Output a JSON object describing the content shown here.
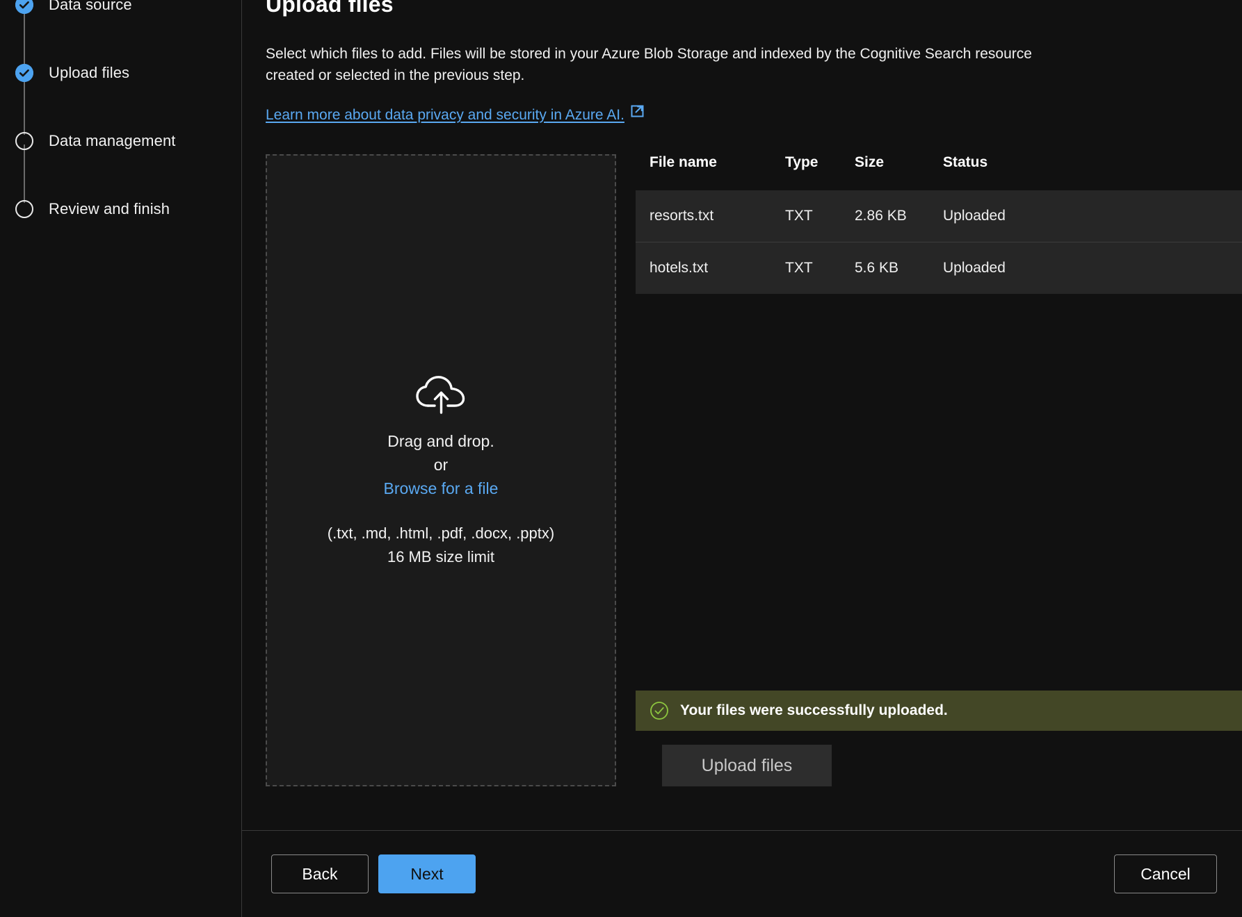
{
  "sidebar": {
    "steps": [
      {
        "label": "Data source",
        "state": "done",
        "icon": "check-circle-icon"
      },
      {
        "label": "Upload files",
        "state": "done",
        "icon": "check-circle-icon"
      },
      {
        "label": "Data management",
        "state": "todo",
        "icon": "empty-circle-icon"
      },
      {
        "label": "Review and finish",
        "state": "todo",
        "icon": "empty-circle-icon"
      }
    ]
  },
  "page": {
    "title": "Upload files",
    "description": "Select which files to add. Files will be stored in your Azure Blob Storage and indexed by the Cognitive Search resource created or selected in the previous step.",
    "learn_more_link": "Learn more about data privacy and security in Azure AI.",
    "learn_more_icon": "external-link-icon"
  },
  "dropzone": {
    "icon": "cloud-upload-icon",
    "line1": "Drag and drop.",
    "or": "or",
    "browse": "Browse for a file",
    "formats": "(.txt, .md, .html, .pdf, .docx, .pptx)",
    "size_limit": "16 MB size limit"
  },
  "files_table": {
    "columns": [
      "File name",
      "Type",
      "Size",
      "Status"
    ],
    "rows": [
      {
        "name": "resorts.txt",
        "type": "TXT",
        "size": "2.86 KB",
        "status": "Uploaded"
      },
      {
        "name": "hotels.txt",
        "type": "TXT",
        "size": "5.6 KB",
        "status": "Uploaded"
      }
    ]
  },
  "banner": {
    "icon": "check-circle-outline-icon",
    "message": "Your files were successfully uploaded."
  },
  "actions": {
    "upload_files": "Upload files",
    "back": "Back",
    "next": "Next",
    "cancel": "Cancel"
  },
  "colors": {
    "accent": "#4da3f0",
    "link": "#5aa9f2",
    "status_success": "#4a9a28",
    "banner_bg": "#434726",
    "banner_icon": "#8dc63f",
    "page_bg": "#111111",
    "row_bg": "#262626",
    "dropzone_bg": "#1b1b1b"
  }
}
